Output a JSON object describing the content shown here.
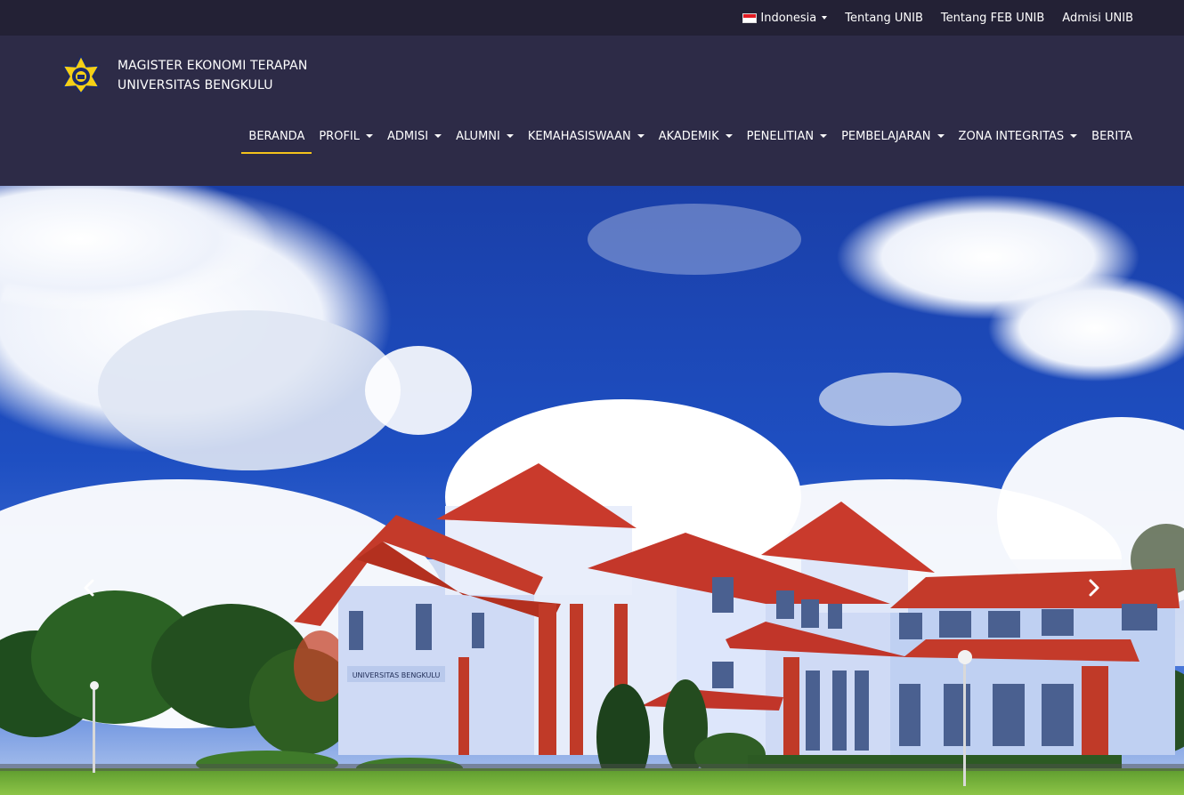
{
  "topbar": {
    "language": "Indonesia",
    "links": [
      "Tentang UNIB",
      "Tentang FEB UNIB",
      "Admisi UNIB"
    ]
  },
  "brand": {
    "line1": "MAGISTER EKONOMI TERAPAN",
    "line2": "UNIVERSITAS BENGKULU"
  },
  "nav": {
    "items": [
      {
        "label": "BERANDA",
        "dropdown": false,
        "active": true
      },
      {
        "label": "PROFIL",
        "dropdown": true
      },
      {
        "label": "ADMISI",
        "dropdown": true
      },
      {
        "label": "ALUMNI",
        "dropdown": true
      },
      {
        "label": "KEMAHASISWAAN",
        "dropdown": true
      },
      {
        "label": "AKADEMIK",
        "dropdown": true
      },
      {
        "label": "PENELITIAN",
        "dropdown": true
      },
      {
        "label": "PEMBELAJARAN",
        "dropdown": true
      },
      {
        "label": "ZONA INTEGRITAS",
        "dropdown": true
      },
      {
        "label": "BERITA",
        "dropdown": false
      }
    ]
  },
  "colors": {
    "topbar_bg": "#232135",
    "header_bg": "#2d2b47",
    "accent": "#f3c21b"
  },
  "hero": {
    "building_sign": "UNIVERSITAS BENGKULU"
  }
}
